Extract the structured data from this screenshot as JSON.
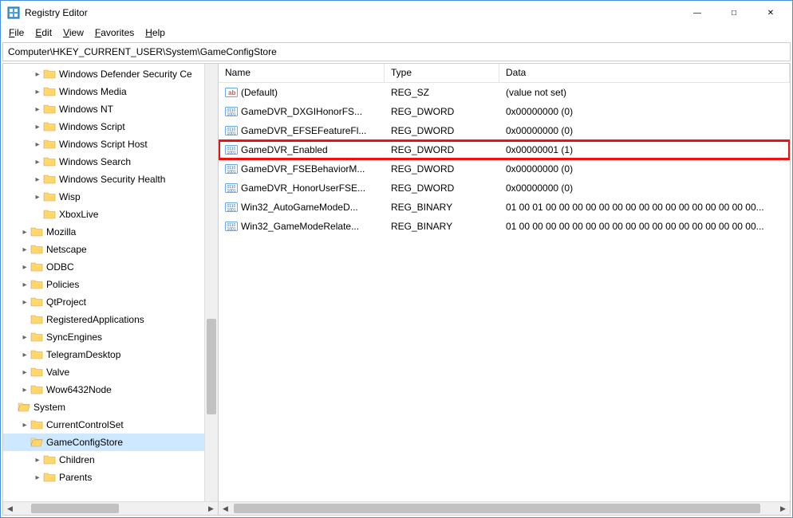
{
  "window": {
    "title": "Registry Editor",
    "menu": [
      "File",
      "Edit",
      "View",
      "Favorites",
      "Help"
    ],
    "address": "Computer\\HKEY_CURRENT_USER\\System\\GameConfigStore"
  },
  "colors": {
    "highlight_border": "#e11",
    "selected_bg": "#cde8ff"
  },
  "columns": {
    "name": "Name",
    "type": "Type",
    "data": "Data"
  },
  "tree": [
    {
      "label": "Windows Defender Security Ce",
      "depth": 2,
      "expander": ">",
      "icon": "folder"
    },
    {
      "label": "Windows Media",
      "depth": 2,
      "expander": ">",
      "icon": "folder"
    },
    {
      "label": "Windows NT",
      "depth": 2,
      "expander": ">",
      "icon": "folder"
    },
    {
      "label": "Windows Script",
      "depth": 2,
      "expander": ">",
      "icon": "folder"
    },
    {
      "label": "Windows Script Host",
      "depth": 2,
      "expander": ">",
      "icon": "folder"
    },
    {
      "label": "Windows Search",
      "depth": 2,
      "expander": ">",
      "icon": "folder"
    },
    {
      "label": "Windows Security Health",
      "depth": 2,
      "expander": ">",
      "icon": "folder"
    },
    {
      "label": "Wisp",
      "depth": 2,
      "expander": ">",
      "icon": "folder"
    },
    {
      "label": "XboxLive",
      "depth": 2,
      "expander": "",
      "icon": "folder"
    },
    {
      "label": "Mozilla",
      "depth": 1,
      "expander": ">",
      "icon": "folder"
    },
    {
      "label": "Netscape",
      "depth": 1,
      "expander": ">",
      "icon": "folder"
    },
    {
      "label": "ODBC",
      "depth": 1,
      "expander": ">",
      "icon": "folder"
    },
    {
      "label": "Policies",
      "depth": 1,
      "expander": ">",
      "icon": "folder"
    },
    {
      "label": "QtProject",
      "depth": 1,
      "expander": ">",
      "icon": "folder"
    },
    {
      "label": "RegisteredApplications",
      "depth": 1,
      "expander": "",
      "icon": "folder"
    },
    {
      "label": "SyncEngines",
      "depth": 1,
      "expander": ">",
      "icon": "folder"
    },
    {
      "label": "TelegramDesktop",
      "depth": 1,
      "expander": ">",
      "icon": "folder"
    },
    {
      "label": "Valve",
      "depth": 1,
      "expander": ">",
      "icon": "folder"
    },
    {
      "label": "Wow6432Node",
      "depth": 1,
      "expander": ">",
      "icon": "folder"
    },
    {
      "label": "System",
      "depth": 0,
      "expander": "",
      "icon": "folder-open"
    },
    {
      "label": "CurrentControlSet",
      "depth": 1,
      "expander": ">",
      "icon": "folder"
    },
    {
      "label": "GameConfigStore",
      "depth": 1,
      "expander": "",
      "icon": "folder-open",
      "selected": true
    },
    {
      "label": "Children",
      "depth": 2,
      "expander": ">",
      "icon": "folder"
    },
    {
      "label": "Parents",
      "depth": 2,
      "expander": ">",
      "icon": "folder"
    }
  ],
  "values": [
    {
      "icon": "string",
      "name": "(Default)",
      "type": "REG_SZ",
      "data": "(value not set)"
    },
    {
      "icon": "binary",
      "name": "GameDVR_DXGIHonorFS...",
      "type": "REG_DWORD",
      "data": "0x00000000 (0)"
    },
    {
      "icon": "binary",
      "name": "GameDVR_EFSEFeatureFl...",
      "type": "REG_DWORD",
      "data": "0x00000000 (0)"
    },
    {
      "icon": "binary",
      "name": "GameDVR_Enabled",
      "type": "REG_DWORD",
      "data": "0x00000001 (1)",
      "highlighted": true
    },
    {
      "icon": "binary",
      "name": "GameDVR_FSEBehaviorM...",
      "type": "REG_DWORD",
      "data": "0x00000000 (0)"
    },
    {
      "icon": "binary",
      "name": "GameDVR_HonorUserFSE...",
      "type": "REG_DWORD",
      "data": "0x00000000 (0)"
    },
    {
      "icon": "binary",
      "name": "Win32_AutoGameModeD...",
      "type": "REG_BINARY",
      "data": "01 00 01 00 00 00 00 00 00 00 00 00 00 00 00 00 00 00 00..."
    },
    {
      "icon": "binary",
      "name": "Win32_GameModeRelate...",
      "type": "REG_BINARY",
      "data": "01 00 00 00 00 00 00 00 00 00 00 00 00 00 00 00 00 00 00..."
    }
  ]
}
